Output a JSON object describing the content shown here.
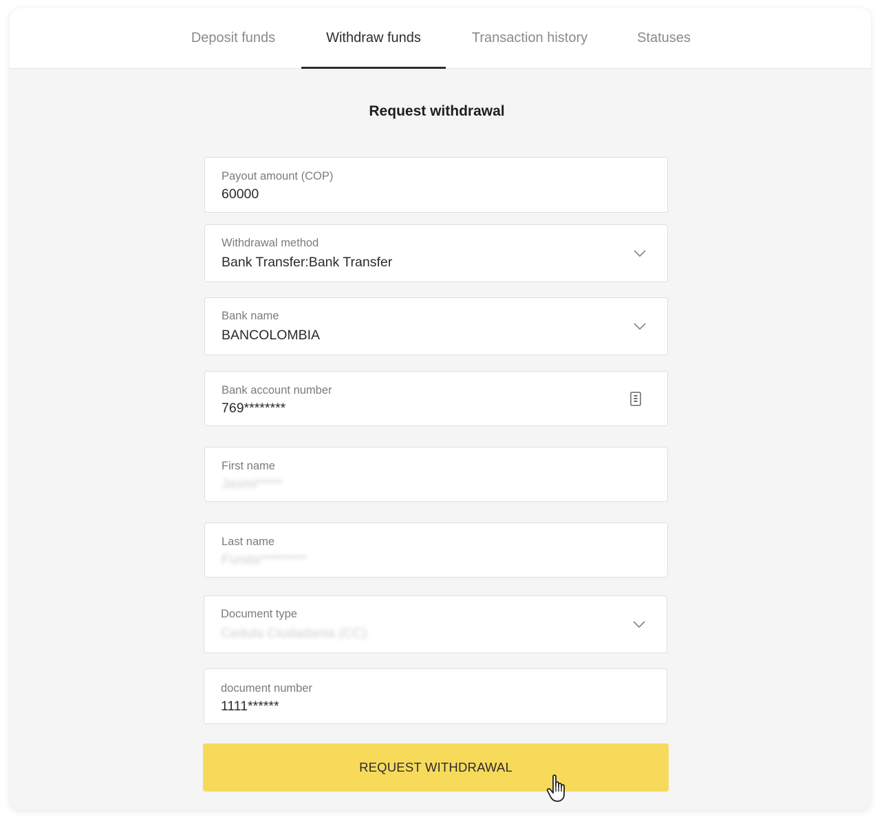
{
  "tabs": [
    {
      "label": "Deposit funds",
      "active": false
    },
    {
      "label": "Withdraw funds",
      "active": true
    },
    {
      "label": "Transaction history",
      "active": false
    },
    {
      "label": "Statuses",
      "active": false
    }
  ],
  "form": {
    "title": "Request withdrawal",
    "fields": [
      {
        "label": "Payout amount (COP)",
        "value": "60000"
      },
      {
        "label": "Withdrawal method",
        "value": "Bank Transfer:Bank Transfer",
        "dropdown": true
      },
      {
        "label": "Bank name",
        "value": "BANCOLOMBIA",
        "dropdown": true
      },
      {
        "label": "Bank account number",
        "value": "769********",
        "icon": "document-icon"
      },
      {
        "label": "First name",
        "value": "Jasmi*****",
        "blurred": true
      },
      {
        "label": "Last name",
        "value": "Funda*********",
        "blurred": true
      },
      {
        "label": "Document type",
        "value": "Cedula Ciudadania (CC)",
        "dropdown": true,
        "blurred": true
      },
      {
        "label": "document number",
        "value": "1111******"
      }
    ],
    "submit_label": "REQUEST WITHDRAWAL"
  },
  "colors": {
    "accent": "#f8da5b",
    "background": "#f5f5f5"
  }
}
